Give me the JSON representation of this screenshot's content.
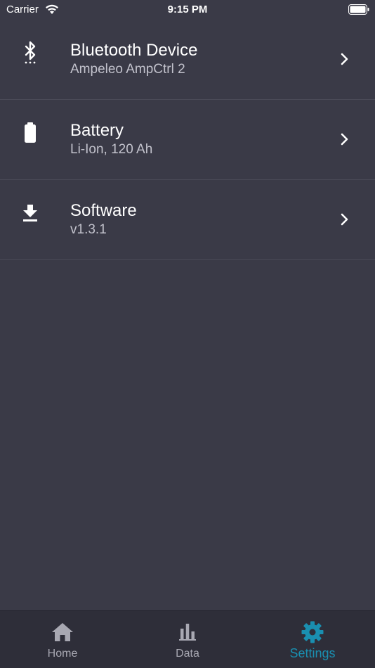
{
  "status_bar": {
    "carrier": "Carrier",
    "time": "9:15 PM",
    "icons": [
      "wifi-icon",
      "battery-icon"
    ]
  },
  "settings": {
    "items": [
      {
        "icon": "bluetooth-icon",
        "title": "Bluetooth Device",
        "subtitle": "Ampeleo AmpCtrl 2"
      },
      {
        "icon": "battery-icon",
        "title": "Battery",
        "subtitle": "Li-Ion, 120 Ah"
      },
      {
        "icon": "download-icon",
        "title": "Software",
        "subtitle": "v1.3.1"
      }
    ]
  },
  "tab_bar": {
    "tabs": [
      {
        "icon": "home-icon",
        "label": "Home",
        "active": false
      },
      {
        "icon": "bar-chart-icon",
        "label": "Data",
        "active": false
      },
      {
        "icon": "gear-icon",
        "label": "Settings",
        "active": true
      }
    ]
  },
  "colors": {
    "background": "#3a3a47",
    "tab_bar_background": "#2e2e39",
    "accent": "#1a8fb0",
    "inactive": "#a8a8b2",
    "subtitle": "#c2c2cc"
  }
}
